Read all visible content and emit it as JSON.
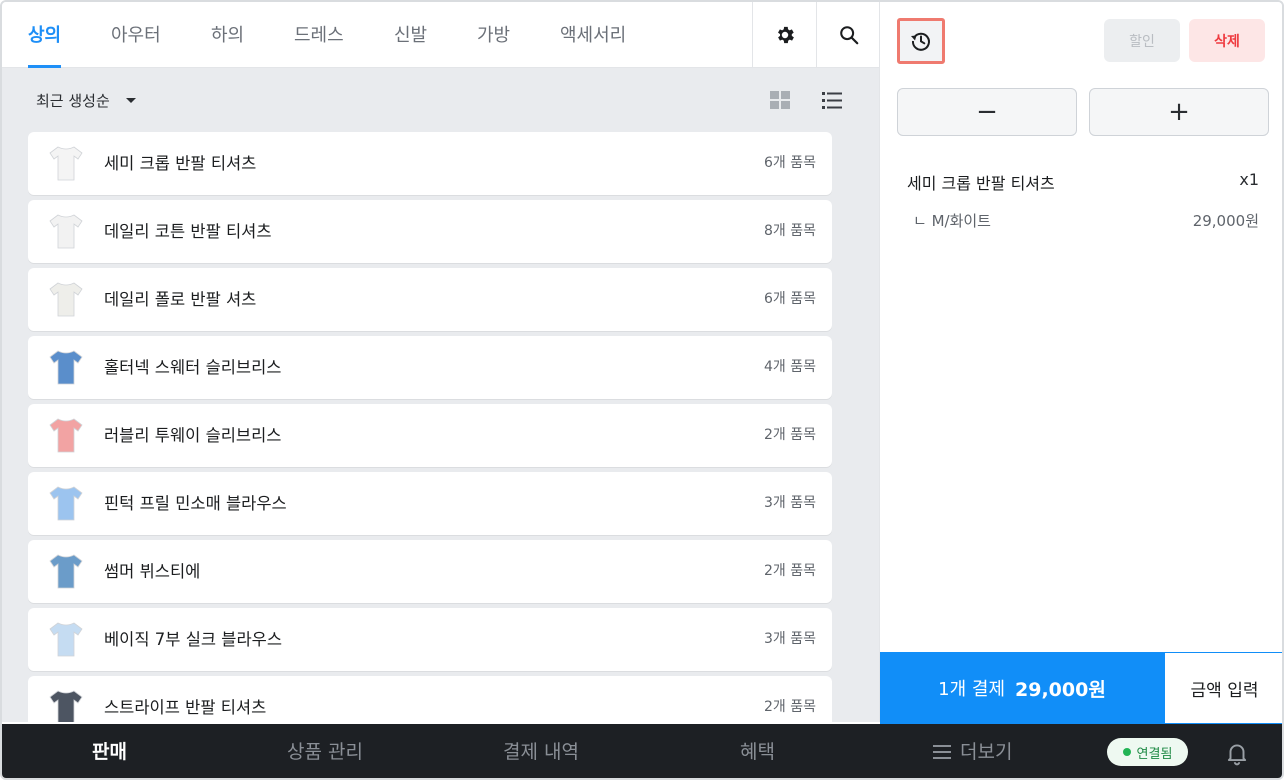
{
  "tabs": [
    "상의",
    "아우터",
    "하의",
    "드레스",
    "신발",
    "가방",
    "액세서리"
  ],
  "active_tab": "상의",
  "icons": {
    "settings": "gear-icon",
    "search": "search-icon",
    "grid_view": "grid-icon",
    "list_view": "list-icon",
    "history": "history-icon",
    "notification": "bell-icon",
    "more": "hamburger-icon"
  },
  "sort": {
    "label": "최근 생성순"
  },
  "products": [
    {
      "name": "세미 크롭 반팔 티셔츠",
      "count": "6개 품목",
      "thumb_color": "#f4f4f4"
    },
    {
      "name": "데일리 코튼 반팔 티셔츠",
      "count": "8개 품목",
      "thumb_color": "#f2f2f2"
    },
    {
      "name": "데일리 폴로 반팔 셔츠",
      "count": "6개 품목",
      "thumb_color": "#eeeeea"
    },
    {
      "name": "홀터넥 스웨터 슬리브리스",
      "count": "4개 품목",
      "thumb_color": "#5a8ecb"
    },
    {
      "name": "러블리 투웨이 슬리브리스",
      "count": "2개 품목",
      "thumb_color": "#f2a3a3"
    },
    {
      "name": "핀턱 프릴 민소매 블라우스",
      "count": "3개 품목",
      "thumb_color": "#9cc4ef"
    },
    {
      "name": "썸머 뷔스티에",
      "count": "2개 품목",
      "thumb_color": "#6b9cc9"
    },
    {
      "name": "베이직 7부 실크 블라우스",
      "count": "3개 품목",
      "thumb_color": "#c5dcf2"
    },
    {
      "name": "스트라이프 반팔 티셔츠",
      "count": "2개 품목",
      "thumb_color": "#4d5562"
    }
  ],
  "cart": {
    "discount_label": "할인",
    "delete_label": "삭제",
    "minus": "−",
    "plus": "+",
    "item": {
      "name": "세미 크롭 반팔 티셔츠",
      "qty": "x1",
      "option": "ㄴ M/화이트",
      "price": "29,000원"
    },
    "pay_count": "1개 결제",
    "pay_total": "29,000원",
    "amount_input_label": "금액 입력"
  },
  "bottom_nav": {
    "items": [
      "판매",
      "상품 관리",
      "결제 내역",
      "혜택",
      "더보기"
    ],
    "active": "판매",
    "status": "연결됨"
  },
  "colors": {
    "accent": "#118ef8",
    "active_tab": "#1e8ff7",
    "delete": "#ef3a3f",
    "highlight_outline": "#ef7a6f",
    "nav_bg": "#1d2024",
    "status_green": "#22b455"
  }
}
